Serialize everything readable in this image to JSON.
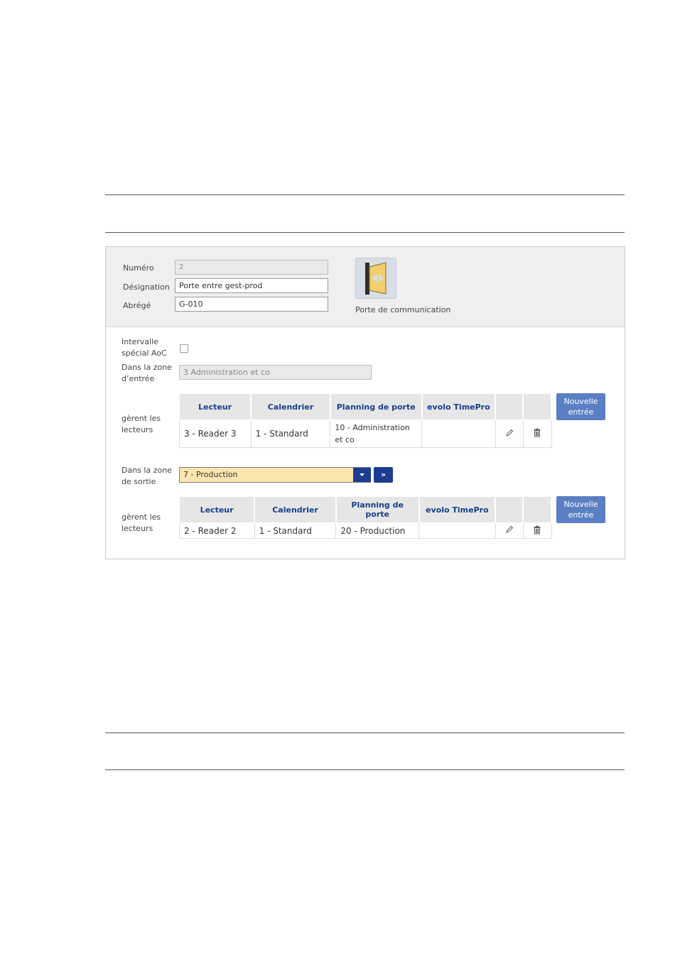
{
  "header_form": {
    "numero_label": "Numéro",
    "numero_value": "2",
    "designation_label": "Désignation",
    "designation_value": "Porte entre gest-prod",
    "abrege_label": "Abrégé",
    "abrege_value": "G-010",
    "door_type_caption": "Porte de communication",
    "door_icon": "door-icon"
  },
  "settings": {
    "intervalle_label_1": "Intervalle",
    "intervalle_label_2": "spécial AoC",
    "intervalle_checked": false,
    "entry_zone_label_1": "Dans la zone",
    "entry_zone_label_2": "d’entrée",
    "entry_zone_value": "3 Administration et co",
    "exit_zone_label_1": "Dans la zone",
    "exit_zone_label_2": "de sortie",
    "exit_zone_value": "7 - Production",
    "exit_goto_icon": "»"
  },
  "entry_readers": {
    "label_1": "gèrent les",
    "label_2": "lecteurs",
    "columns": [
      "Lecteur",
      "Calendrier",
      "Planning de porte",
      "evolo TimePro"
    ],
    "rows": [
      {
        "lecteur": "3 - Reader 3",
        "calendrier": "1 - Standard",
        "planning_1": "10 - Administration",
        "planning_2": "et co",
        "timepro": ""
      }
    ],
    "new_button_1": "Nouvelle",
    "new_button_2": "entrée"
  },
  "exit_readers": {
    "label_1": "gèrent les",
    "label_2": "lecteurs",
    "columns": [
      "Lecteur",
      "Calendrier",
      "Planning de porte",
      "evolo TimePro"
    ],
    "rows": [
      {
        "lecteur": "2 - Reader 2",
        "calendrier": "1 - Standard",
        "planning": "20 - Production",
        "timepro": ""
      }
    ],
    "new_button_1": "Nouvelle",
    "new_button_2": "entrée"
  },
  "icons": {
    "edit": "pencil-icon",
    "delete": "trash-icon"
  },
  "colors": {
    "header_text": "#173f8c",
    "button": "#5b7fc3",
    "select_highlight": "#fce6b0",
    "dark_button": "#1b3c91"
  }
}
